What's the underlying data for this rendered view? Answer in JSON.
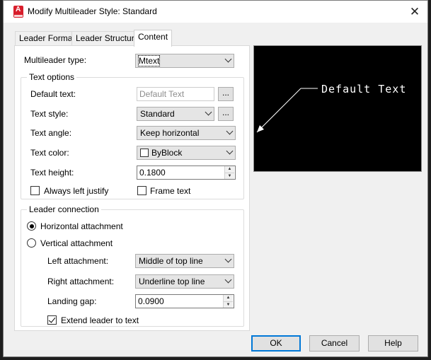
{
  "window": {
    "title": "Modify Multileader Style: Standard",
    "close": "✕"
  },
  "tabs": [
    {
      "label": "Leader Format"
    },
    {
      "label": "Leader Structure"
    },
    {
      "label": "Content"
    }
  ],
  "content": {
    "multileader_type": {
      "label": "Multileader type:",
      "value": "Mtext"
    },
    "text_options": {
      "title": "Text options",
      "default_text": {
        "label": "Default text:",
        "value": "Default Text",
        "button": "..."
      },
      "text_style": {
        "label": "Text style:",
        "value": "Standard",
        "button": "..."
      },
      "text_angle": {
        "label": "Text angle:",
        "value": "Keep horizontal"
      },
      "text_color": {
        "label": "Text color:",
        "value": "ByBlock"
      },
      "text_height": {
        "label": "Text height:",
        "value": "0.1800"
      },
      "always_left_justify": {
        "label": "Always left justify",
        "checked": false
      },
      "frame_text": {
        "label": "Frame text",
        "checked": false
      }
    },
    "leader_connection": {
      "title": "Leader connection",
      "horizontal": {
        "label": "Horizontal attachment",
        "selected": true
      },
      "vertical": {
        "label": "Vertical attachment",
        "selected": false
      },
      "left_attachment": {
        "label": "Left attachment:",
        "value": "Middle of top line"
      },
      "right_attachment": {
        "label": "Right attachment:",
        "value": "Underline top line"
      },
      "landing_gap": {
        "label": "Landing gap:",
        "value": "0.0900"
      },
      "extend_leader": {
        "label": "Extend leader to text",
        "checked": true
      }
    }
  },
  "preview": {
    "text": "Default Text",
    "background": "#000000",
    "foreground": "#ffffff"
  },
  "buttons": {
    "ok": "OK",
    "cancel": "Cancel",
    "help": "Help"
  }
}
